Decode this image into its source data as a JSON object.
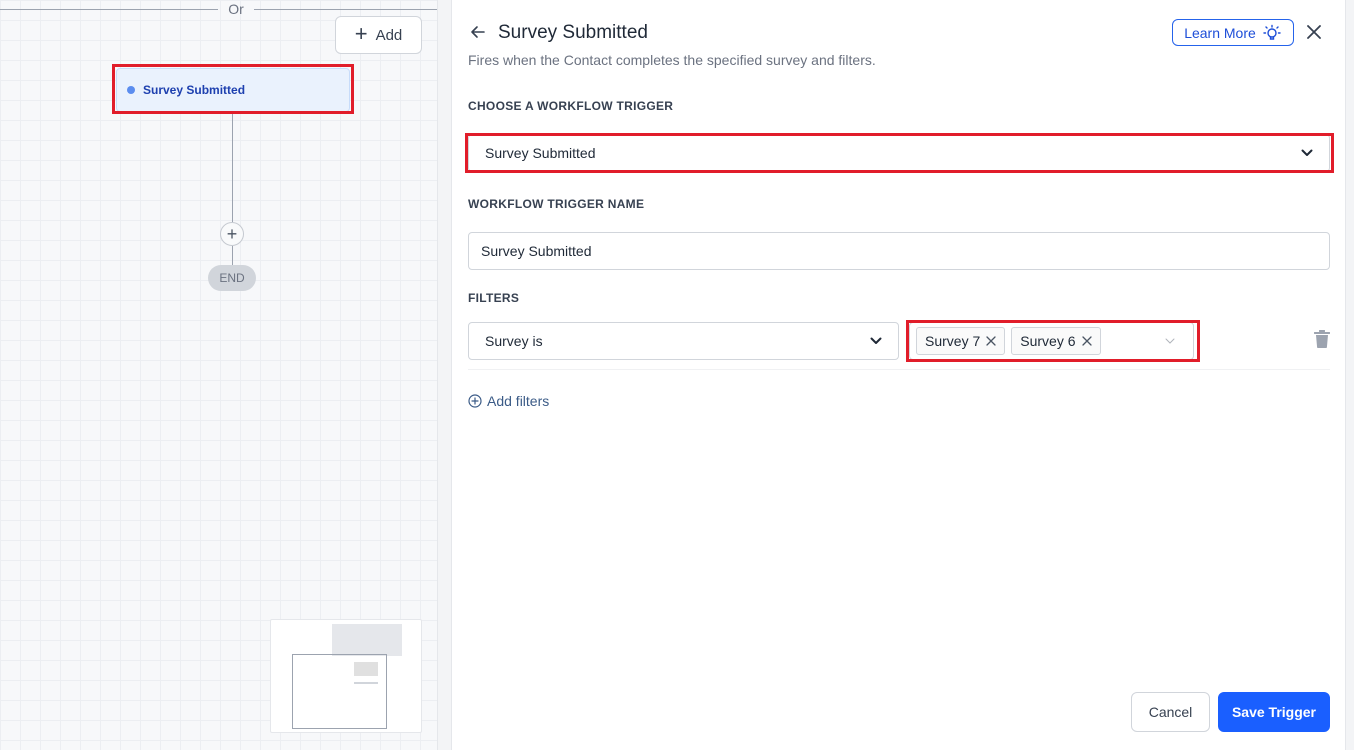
{
  "canvas": {
    "or_label": "Or",
    "add_button_label": "Add",
    "trigger_node_label": "Survey Submitted",
    "end_label": "END"
  },
  "drawer": {
    "title": "Survey Submitted",
    "subtitle": "Fires when the Contact completes the specified survey and filters.",
    "learn_more_label": "Learn More",
    "choose_trigger_label": "CHOOSE A WORKFLOW TRIGGER",
    "trigger_selected": "Survey Submitted",
    "trigger_name_label": "WORKFLOW TRIGGER NAME",
    "trigger_name_value": "Survey Submitted",
    "filters_label": "FILTERS",
    "filters": [
      {
        "field": "Survey is",
        "values": [
          "Survey 7",
          "Survey 6"
        ]
      }
    ],
    "add_filters_label": "Add filters",
    "cancel_label": "Cancel",
    "save_label": "Save Trigger"
  },
  "colors": {
    "primary": "#1a5fff",
    "highlight_red": "#e11d2a",
    "node_bg": "#eaf2fd",
    "node_text": "#1e40af"
  },
  "icons": {
    "back": "arrow-left-icon",
    "learn_more": "lightbulb-icon",
    "close": "close-icon",
    "dropdown": "chevron-down-icon",
    "chip_remove": "x-icon",
    "delete": "trash-icon",
    "add_filter": "plus-circle-icon"
  }
}
